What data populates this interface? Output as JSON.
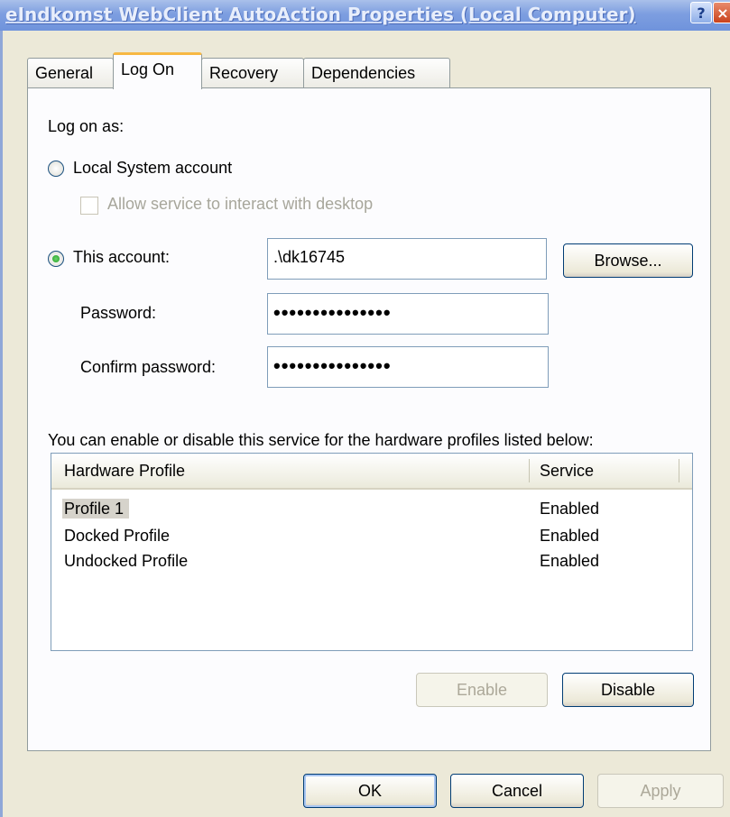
{
  "window": {
    "title": "eIndkomst WebClient AutoAction Properties (Local Computer)",
    "help_glyph": "?",
    "close_glyph": "×"
  },
  "tabs": [
    {
      "label": "General"
    },
    {
      "label": "Log On"
    },
    {
      "label": "Recovery"
    },
    {
      "label": "Dependencies"
    }
  ],
  "logon": {
    "log_on_as": "Log on as:",
    "local_system_label": "Local System account",
    "interact_label": "Allow service to interact with desktop",
    "this_account_label": "This account:",
    "account_value": ".\\dk16745",
    "browse_label": "Browse...",
    "password_label": "Password:",
    "password_value": "•••••••••••••••",
    "confirm_label": "Confirm password:",
    "confirm_value": "•••••••••••••••"
  },
  "profiles": {
    "description": "You can enable or disable this service for the hardware profiles listed below:",
    "columns": [
      "Hardware Profile",
      "Service"
    ],
    "rows": [
      {
        "profile": "Profile 1",
        "service": "Enabled"
      },
      {
        "profile": "Docked Profile",
        "service": "Enabled"
      },
      {
        "profile": "Undocked Profile",
        "service": "Enabled"
      }
    ],
    "enable_label": "Enable",
    "disable_label": "Disable"
  },
  "footer": {
    "ok_label": "OK",
    "cancel_label": "Cancel",
    "apply_label": "Apply"
  }
}
